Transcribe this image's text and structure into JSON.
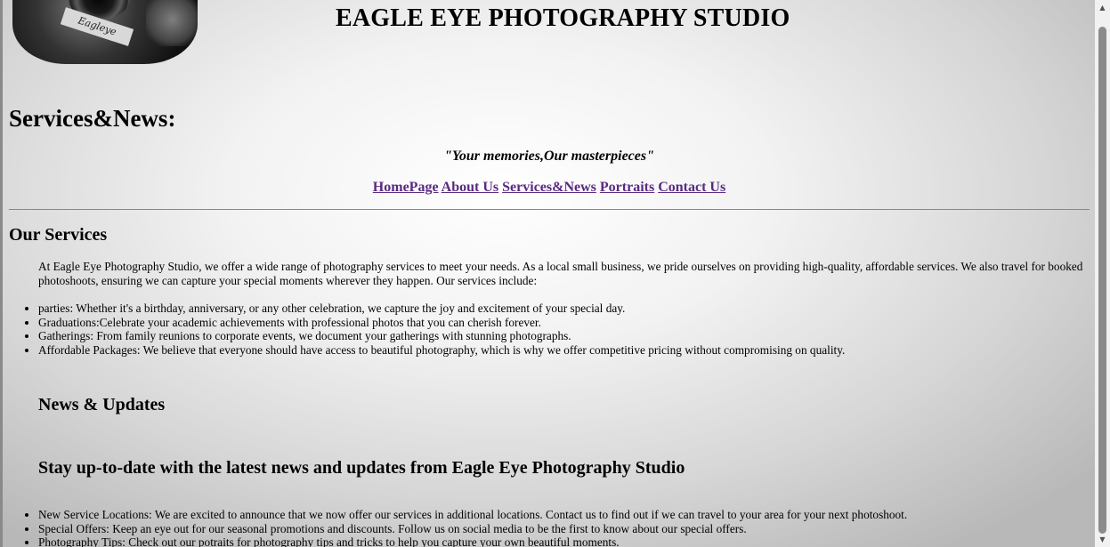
{
  "header": {
    "studio_title": "EAGLE EYE PHOTOGRAPHY STUDIO",
    "logo_text": "Eagleye"
  },
  "page_heading": "Services&News:",
  "tagline": "\"Your memories,Our masterpieces\"",
  "nav": {
    "items": [
      "HomePage",
      "About Us",
      "Services&News",
      "Portraits",
      "Contact Us"
    ]
  },
  "services": {
    "heading": "Our Services",
    "intro": "At Eagle Eye Photography Studio, we offer a wide range of photography services to meet your needs. As a local small business, we pride ourselves on providing high-quality, affordable services. We also travel for booked photoshoots, ensuring we can capture your special moments wherever they happen. Our services include:",
    "items": [
      "parties: Whether it's a birthday, anniversary, or any other celebration, we capture the joy and excitement of your special day.",
      "Graduations:Celebrate your academic achievements with professional photos that you can cherish forever.",
      "Gatherings: From family reunions to corporate events, we document your gatherings with stunning photographs.",
      "Affordable Packages: We believe that everyone should have access to beautiful photography, which is why we offer competitive pricing without compromising on quality."
    ]
  },
  "news": {
    "heading": "News & Updates",
    "subheading": "Stay up-to-date with the latest news and updates from Eagle Eye Photography Studio",
    "items": [
      "New Service Locations: We are excited to announce that we now offer our services in additional locations. Contact us to find out if we can travel to your area for your next photoshoot.",
      "Special Offers: Keep an eye out for our seasonal promotions and discounts. Follow us on social media to be the first to know about our special offers.",
      "Photography Tips: Check out our potraits for photography tips and tricks to help you capture your own beautiful moments."
    ]
  },
  "colors": {
    "link": "#5a2a82",
    "rule": "#888888"
  }
}
